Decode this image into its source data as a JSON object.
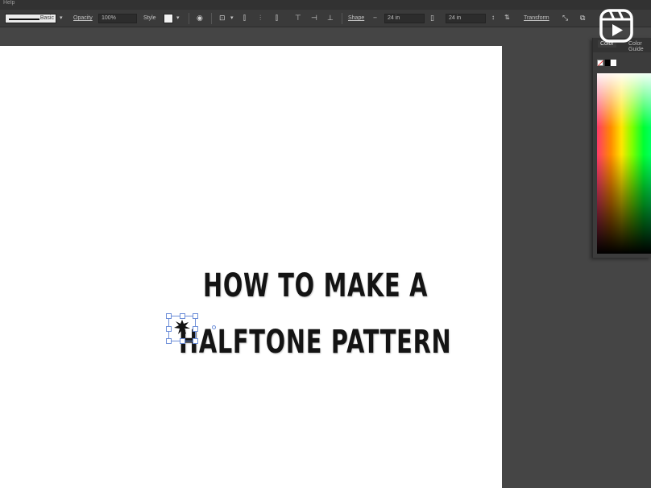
{
  "menubar": {
    "label": "Help"
  },
  "controlbar": {
    "stroke_style": "Basic",
    "opacity_label": "Opacity",
    "opacity_value": "100%",
    "style_label": "Style",
    "shape_label": "Shape",
    "width_value": "24 in",
    "height_value": "24 in",
    "transform_label": "Transform"
  },
  "canvas": {
    "headline_line1": "HOW TO MAKE A",
    "headline_line2": "HALFTONE PATTERN"
  },
  "color_panel": {
    "tab_color": "Color",
    "tab_color_guide": "Color Guide"
  },
  "icons": {
    "overlay": "reels-icon",
    "color_picker": "color-spectrum"
  },
  "colors": {
    "workspace": "#454545",
    "artboard": "#ffffff",
    "selection": "#6d8ed8",
    "headline": "#141414"
  }
}
